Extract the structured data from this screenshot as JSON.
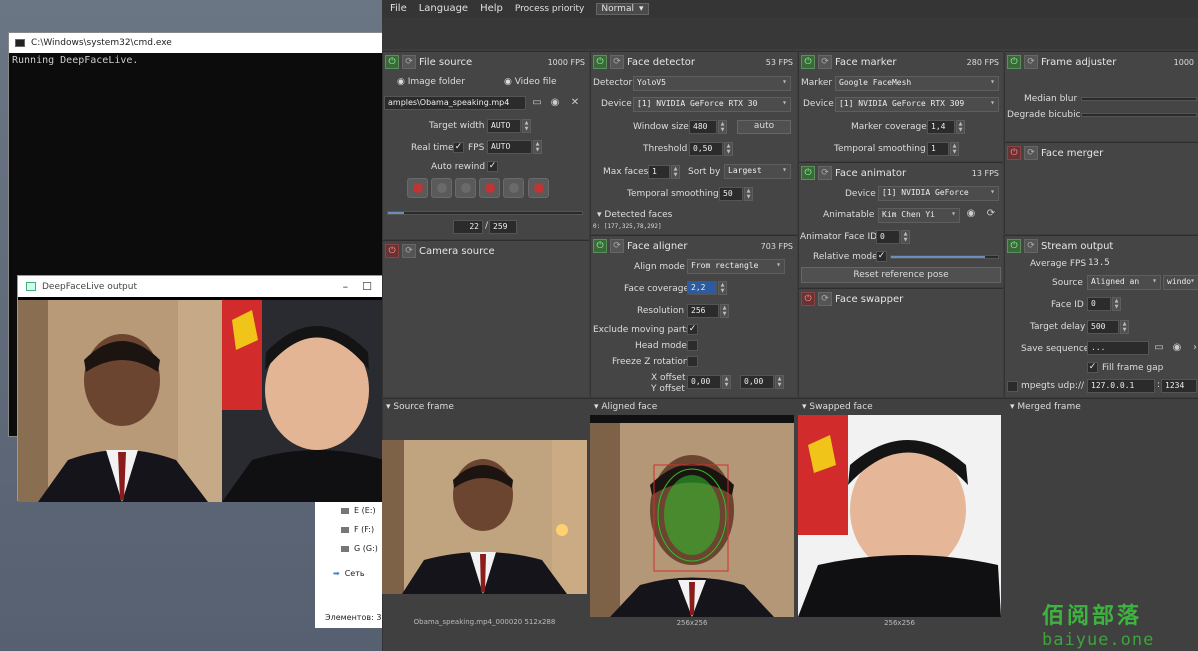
{
  "cmd": {
    "title": "C:\\Windows\\system32\\cmd.exe",
    "line": "Running DeepFaceLive."
  },
  "output_window": {
    "title": "DeepFaceLive output"
  },
  "explorer": {
    "items": [
      "E (E:)",
      "F (F:)",
      "G (G:)",
      "Сеть"
    ],
    "status": "Элементов: 3"
  },
  "menu": {
    "file": "File",
    "language": "Language",
    "help": "Help",
    "priority_label": "Process priority",
    "priority_value": "Normal"
  },
  "file_source": {
    "title": "File source",
    "fps": "1000 FPS",
    "image_folder": "Image folder",
    "video_file": "Video file",
    "path": "amples\\Obama_speaking.mp4",
    "target_width_label": "Target width",
    "target_width": "AUTO",
    "realtime_label": "Real time",
    "fps_label": "FPS",
    "fps_value": "AUTO",
    "autorewind_label": "Auto rewind",
    "frame": "22",
    "total": "259",
    "progress": 0.085
  },
  "camera_source": {
    "title": "Camera source"
  },
  "face_detector": {
    "title": "Face detector",
    "fps": "53 FPS",
    "detector_label": "Detector",
    "detector": "YoloV5",
    "device_label": "Device",
    "device": "[1] NVIDIA GeForce RTX 30",
    "window_size_label": "Window size",
    "window_size": "480",
    "auto": "auto",
    "threshold_label": "Threshold",
    "threshold": "0,50",
    "max_faces_label": "Max faces",
    "max_faces": "1",
    "sort_by_label": "Sort by",
    "sort_by": "Largest",
    "temporal_label": "Temporal smoothing",
    "temporal": "50",
    "detected_label": "Detected faces",
    "detected_value": "0: [177,325,78,292]"
  },
  "face_aligner": {
    "title": "Face aligner",
    "fps": "703 FPS",
    "align_mode_label": "Align mode",
    "align_mode": "From rectangle",
    "coverage_label": "Face coverage",
    "coverage": "2,2",
    "resolution_label": "Resolution",
    "resolution": "256",
    "exclude_label": "Exclude moving parts",
    "head_label": "Head mode",
    "freeze_label": "Freeze Z rotation",
    "x_offset_label": "X offset",
    "y_offset_label": "Y offset",
    "x_offset": "0,00",
    "y_offset": "0,00"
  },
  "face_marker": {
    "title": "Face marker",
    "fps": "280 FPS",
    "marker_label": "Marker",
    "marker": "Google FaceMesh",
    "device_label": "Device",
    "device": "[1] NVIDIA GeForce RTX 309",
    "coverage_label": "Marker coverage",
    "coverage": "1,4",
    "temporal_label": "Temporal smoothing",
    "temporal": "1"
  },
  "face_animator": {
    "title": "Face animator",
    "fps": "13 FPS",
    "device_label": "Device",
    "device": "[1] NVIDIA GeForce",
    "animatable_label": "Animatable",
    "animatable": "Kim Chen Yi",
    "face_id_label": "Animator Face ID",
    "face_id": "0",
    "relative_label": "Relative mode",
    "reset_label": "Reset reference pose"
  },
  "face_swapper": {
    "title": "Face swapper"
  },
  "frame_adjuster": {
    "title": "Frame adjuster",
    "fps": "1000",
    "median_label": "Median blur",
    "degrade_label": "Degrade bicubic"
  },
  "face_merger": {
    "title": "Face merger"
  },
  "stream_output": {
    "title": "Stream output",
    "avg_fps_label": "Average FPS",
    "avg_fps": "13.5",
    "source_label": "Source",
    "source": "Aligned an",
    "window": "windo",
    "face_id_label": "Face ID",
    "face_id": "0",
    "delay_label": "Target delay",
    "delay": "500",
    "save_label": "Save sequence",
    "save_path": "...",
    "fill_gap_label": "Fill frame gap",
    "mpegts_label": "mpegts udp://",
    "mpegts_host": "127.0.0.1",
    "mpegts_port": "1234"
  },
  "previews": {
    "source": "Source frame",
    "source_cap": "Obama_speaking.mp4_000020 512x288",
    "aligned": "Aligned face",
    "aligned_cap": "256x256",
    "swapped": "Swapped face",
    "swapped_cap": "256x256",
    "merged": "Merged frame"
  },
  "watermark": {
    "line1": "佰阅部落",
    "line2": "baiyue.one"
  }
}
